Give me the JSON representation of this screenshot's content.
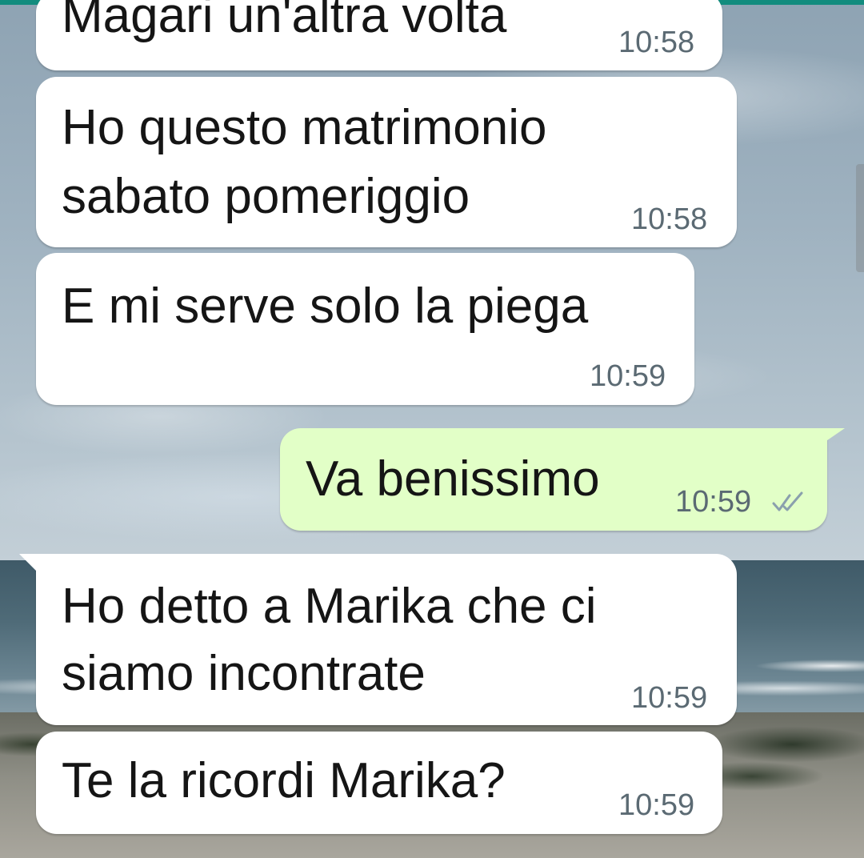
{
  "chat": {
    "messages": [
      {
        "direction": "in",
        "lines": [
          "Magari un'altra volta"
        ],
        "time": "10:58"
      },
      {
        "direction": "in",
        "lines": [
          "Ho questo matrimonio",
          "sabato pomeriggio"
        ],
        "time": "10:58"
      },
      {
        "direction": "in",
        "lines": [
          "E mi serve solo la piega"
        ],
        "time": "10:59"
      },
      {
        "direction": "out",
        "lines": [
          "Va benissimo"
        ],
        "time": "10:59",
        "status_icon": "double-check-read-icon"
      },
      {
        "direction": "in",
        "lines": [
          "Ho detto a Marika che ci",
          "siamo incontrate"
        ],
        "time": "10:59"
      },
      {
        "direction": "in",
        "lines": [
          "Te la ricordi Marika?"
        ],
        "time": "10:59"
      }
    ]
  },
  "colors": {
    "incoming_bubble": "#ffffff",
    "outgoing_bubble": "#e2ffc7",
    "timestamp": "#5b6a73",
    "read_receipt": "#8aa0ad",
    "top_strip": "#128c7e"
  }
}
